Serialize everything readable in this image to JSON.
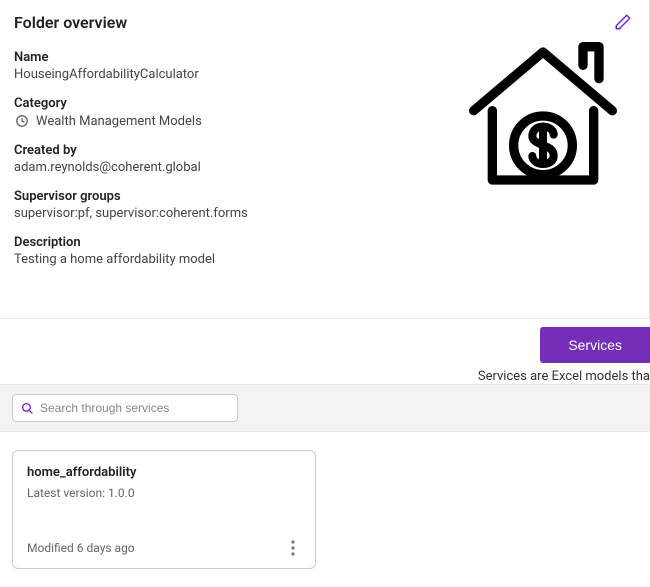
{
  "overview": {
    "title": "Folder overview",
    "name_label": "Name",
    "name_value": "HouseingAffordabilityCalculator",
    "category_label": "Category",
    "category_value": "Wealth Management Models",
    "createdby_label": "Created by",
    "createdby_value": "adam.reynolds@coherent.global",
    "supervisor_label": "Supervisor groups",
    "supervisor_value": "supervisor:pf, supervisor:coherent.forms",
    "description_label": "Description",
    "description_value": "Testing a home affordability model"
  },
  "tabs": {
    "services_label": "Services",
    "services_desc": "Services are Excel models tha"
  },
  "search": {
    "placeholder": "Search through services"
  },
  "cards": [
    {
      "title": "home_affordability",
      "version_prefix": "Latest version: ",
      "version": "1.0.0",
      "modified": "Modified 6 days ago"
    }
  ]
}
